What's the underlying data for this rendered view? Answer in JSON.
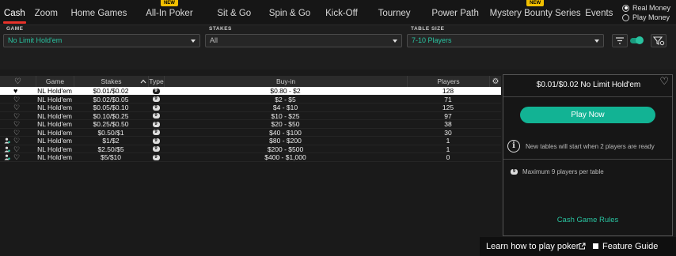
{
  "nav": {
    "tabs": [
      {
        "label": "Cash",
        "active": true,
        "new": false
      },
      {
        "label": "Zoom",
        "active": false,
        "new": false
      },
      {
        "label": "Home Games",
        "active": false,
        "new": false
      },
      {
        "label": "All-In Poker",
        "active": false,
        "new": true
      },
      {
        "label": "Sit & Go",
        "active": false,
        "new": false
      },
      {
        "label": "Spin & Go",
        "active": false,
        "new": false
      },
      {
        "label": "Kick-Off",
        "active": false,
        "new": false
      },
      {
        "label": "Tourney",
        "active": false,
        "new": false
      },
      {
        "label": "Power Path",
        "active": false,
        "new": false
      },
      {
        "label": "Mystery Bounty Series",
        "active": false,
        "new": true
      },
      {
        "label": "Events",
        "active": false,
        "new": false
      }
    ],
    "new_badge": "NEW",
    "money": {
      "real": "Real Money",
      "play": "Play Money",
      "selected": "real"
    }
  },
  "filters": {
    "game_label": "GAME",
    "game_value": "No Limit Hold'em",
    "stakes_label": "STAKES",
    "stakes_value": "All",
    "table_size_label": "TABLE SIZE",
    "table_size_value": "7-10 Players"
  },
  "table": {
    "headers": {
      "game": "Game",
      "stakes": "Stakes",
      "type": "Type",
      "buyin": "Buy-in",
      "players": "Players"
    },
    "rows": [
      {
        "game": "NL Hold'em",
        "stakes": "$0.01/$0.02",
        "type": "9",
        "buyin": "$0.80 - $2",
        "players": "128",
        "favorite": true,
        "selected": true,
        "person": false
      },
      {
        "game": "NL Hold'em",
        "stakes": "$0.02/$0.05",
        "type": "9",
        "buyin": "$2 - $5",
        "players": "71",
        "favorite": false,
        "selected": false,
        "person": false
      },
      {
        "game": "NL Hold'em",
        "stakes": "$0.05/$0.10",
        "type": "9",
        "buyin": "$4 - $10",
        "players": "125",
        "favorite": false,
        "selected": false,
        "person": false
      },
      {
        "game": "NL Hold'em",
        "stakes": "$0.10/$0.25",
        "type": "9",
        "buyin": "$10 - $25",
        "players": "97",
        "favorite": false,
        "selected": false,
        "person": false
      },
      {
        "game": "NL Hold'em",
        "stakes": "$0.25/$0.50",
        "type": "9",
        "buyin": "$20 - $50",
        "players": "38",
        "favorite": false,
        "selected": false,
        "person": false
      },
      {
        "game": "NL Hold'em",
        "stakes": "$0.50/$1",
        "type": "9",
        "buyin": "$40 - $100",
        "players": "30",
        "favorite": false,
        "selected": false,
        "person": false
      },
      {
        "game": "NL Hold'em",
        "stakes": "$1/$2",
        "type": "9",
        "buyin": "$80 - $200",
        "players": "1",
        "favorite": false,
        "selected": false,
        "person": true
      },
      {
        "game": "NL Hold'em",
        "stakes": "$2.50/$5",
        "type": "9",
        "buyin": "$200 - $500",
        "players": "1",
        "favorite": false,
        "selected": false,
        "person": true
      },
      {
        "game": "NL Hold'em",
        "stakes": "$5/$10",
        "type": "9",
        "buyin": "$400 - $1,000",
        "players": "0",
        "favorite": false,
        "selected": false,
        "person": true
      }
    ]
  },
  "panel": {
    "title": "$0.01/$0.02  No Limit Hold'em",
    "play_button": "Play Now",
    "info_text": "New tables will start when 2 players are ready",
    "max_badge": "9",
    "max_text": "Maximum 9 players per table",
    "rules_link": "Cash Game Rules"
  },
  "bottom": {
    "learn": "Learn how to play poker",
    "feature_guide": "Feature Guide"
  },
  "colors": {
    "accent": "#29c3a0",
    "play_button": "#12b394",
    "active_tab_underline": "#e8322a",
    "new_badge": "#f2c000"
  }
}
